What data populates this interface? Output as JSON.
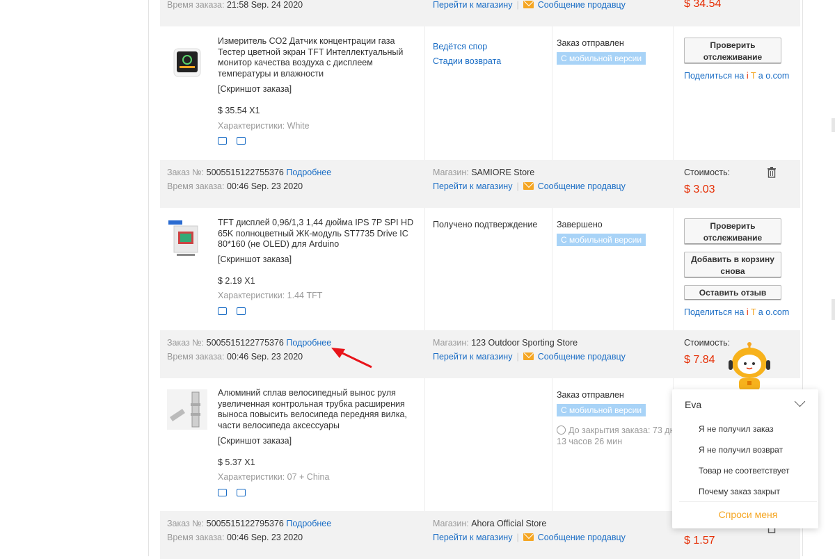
{
  "labels": {
    "order_no": "Заказ №:",
    "order_time": "Время заказа:",
    "details": "Подробнее",
    "shop": "Магазин:",
    "go_to_shop": "Перейти к магазину",
    "message_seller": "Сообщение продавцу",
    "cost": "Стоимость:",
    "screenshot": "[Скриншот заказа]",
    "specs": "Характеристики:",
    "mobile_badge": "С мобильной версии",
    "track": "Проверить отслеживание",
    "rebuy": "Добавить в корзину снова",
    "review": "Оставить отзыв",
    "share_prefix": "Поделиться на",
    "share_brand": [
      "i",
      "T",
      "a",
      "o",
      ".com"
    ]
  },
  "order0": {
    "time": "21:58 Sep. 24 2020",
    "cost": "$ 34.54",
    "product": {
      "title": "Измеритель CO2 Датчик концентрации газа Тестер цветной экран TFT Интеллектуальный монитор качества воздуха с дисплеем температуры и влажности",
      "price_qty": "$ 35.54 X1",
      "specs_value": "White"
    },
    "dispute": "Ведётся спор",
    "return_stages": "Стадии возврата",
    "status": "Заказ отправлен"
  },
  "order1": {
    "number": "5005515122755376",
    "time": "00:46 Sep. 23 2020",
    "shop": "SAMIORE Store",
    "cost": "$ 3.03",
    "product": {
      "title": "TFT дисплей 0,96/1,3 1,44 дюйма IPS 7P SPI HD 65K полноцветный ЖК-модуль ST7735 Drive IC 80*160 (не OLED) для Arduino",
      "price_qty": "$ 2.19 X1",
      "specs_value": "1.44 TFT"
    },
    "confirmation": "Получено подтверждение",
    "status": "Завершено"
  },
  "order2": {
    "number": "5005515122775376",
    "time": "00:46 Sep. 23 2020",
    "shop": "123 Outdoor Sporting Store",
    "cost": "$ 7.84",
    "product": {
      "title": "Алюминий сплав велосипедный вынос руля увеличенная контрольная трубка расширения выноса повысить велосипеда передняя вилка, части велосипеда аксессуары",
      "price_qty": "$ 5.37 X1",
      "specs_value": "07 + China"
    },
    "status": "Заказ отправлен",
    "countdown": "До закрытия заказа: 73 дн 13 часов 26 мин"
  },
  "order3": {
    "number": "5005515122795376",
    "time": "00:46 Sep. 23 2020",
    "shop": "Ahora Official Store",
    "cost": "$ 1.57"
  },
  "assistant": {
    "name": "Eva",
    "options": [
      "Я не получил заказ",
      "Я не получил возврат",
      "Товар не соответствует",
      "Почему заказ закрыт"
    ],
    "ask": "Спроси меня"
  },
  "colors": {
    "accent_link": "#1a6dc5",
    "price": "#e62e04",
    "badge": "#a8d3f7",
    "envelope": "#f5a623",
    "annotation_arrow": "#e8141a"
  }
}
